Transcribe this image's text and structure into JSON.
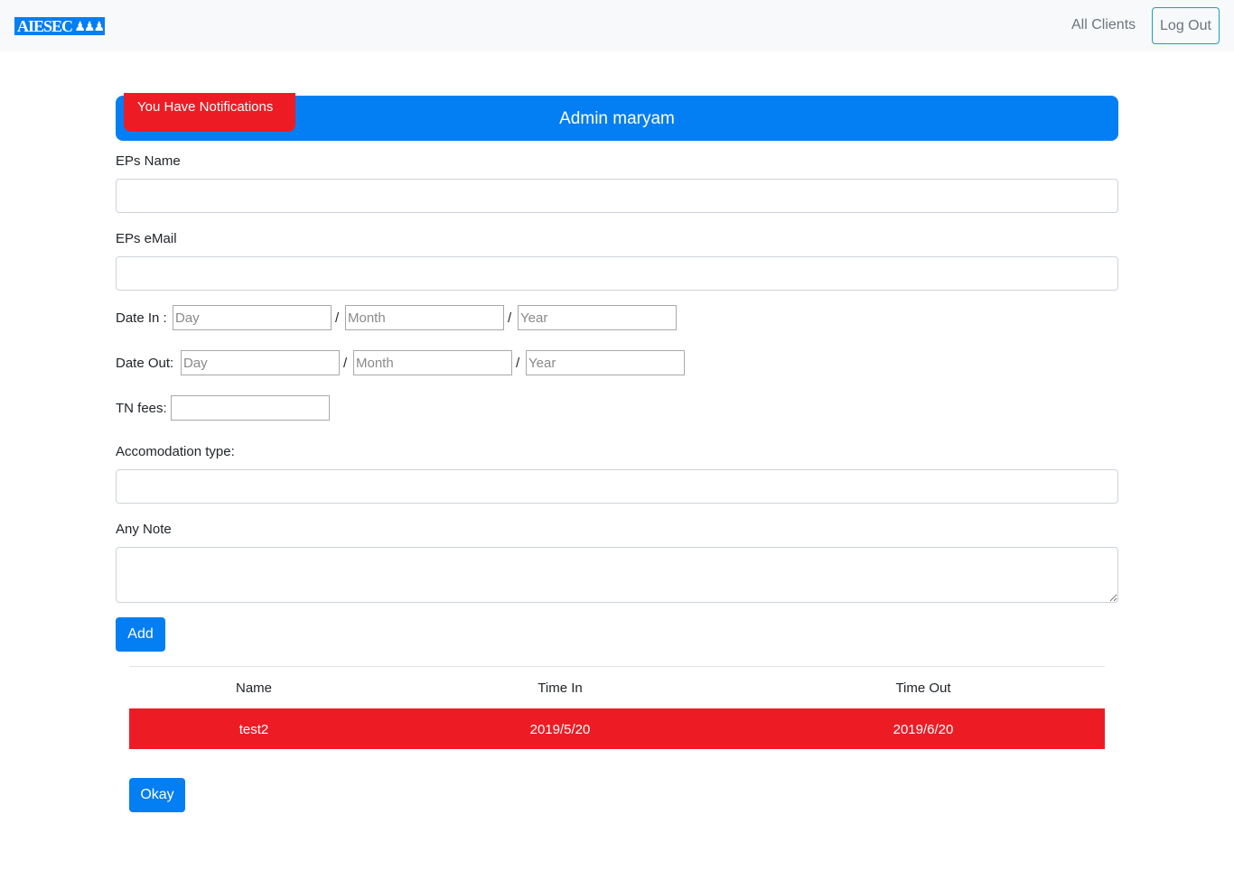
{
  "navbar": {
    "logo_text": "AIESEC",
    "all_clients": "All Clients",
    "logout": "Log Out"
  },
  "header": {
    "title": "Admin maryam",
    "notification": "You Have Notifications"
  },
  "form": {
    "name_label": "EPs Name",
    "email_label": "EPs eMail",
    "date_in_label": "Date In :",
    "date_out_label": "Date Out:",
    "day_placeholder": "Day",
    "month_placeholder": "Month",
    "year_placeholder": "Year",
    "separator": "/",
    "fees_label": "TN fees:",
    "accommodation_label": "Accomodation type:",
    "note_label": "Any Note",
    "add_button": "Add"
  },
  "table": {
    "headers": [
      "Name",
      "Time In",
      "Time Out"
    ],
    "rows": [
      {
        "name": "test2",
        "time_in": "2019/5/20",
        "time_out": "2019/6/20"
      }
    ]
  },
  "okay_button": "Okay",
  "colors": {
    "brand": "#037ef3",
    "alert": "#ed1c24",
    "navbar_bg": "#f8f9fa"
  }
}
